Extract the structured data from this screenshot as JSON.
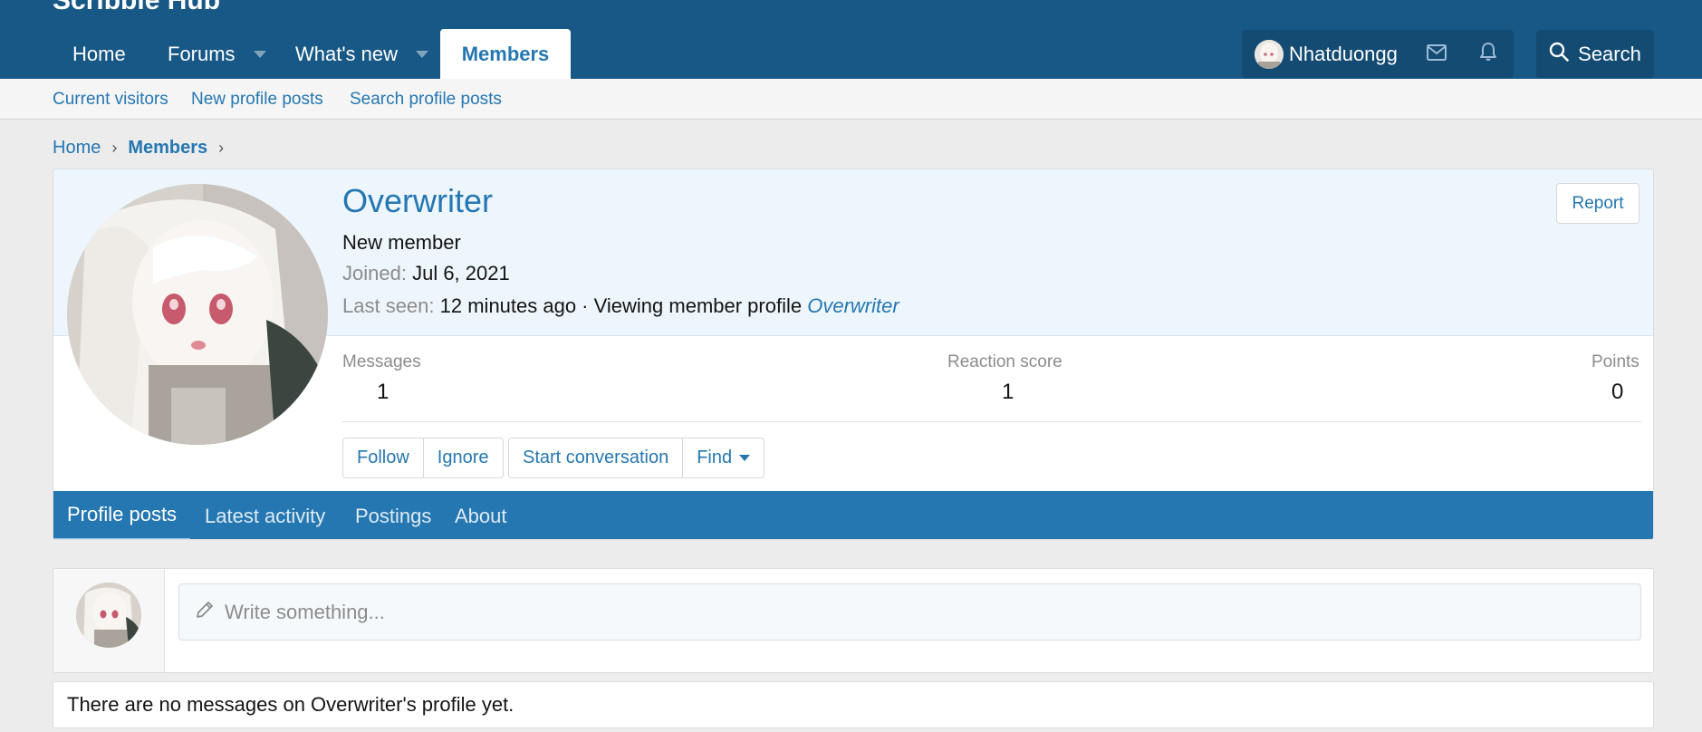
{
  "site": {
    "title": "Scribble Hub"
  },
  "nav": {
    "home": "Home",
    "forums": "Forums",
    "whats_new": "What's new",
    "members": "Members"
  },
  "user_bar": {
    "username": "Nhatduongg",
    "inbox_icon": "envelope-icon",
    "alerts_icon": "bell-icon",
    "search_label": "Search"
  },
  "subnav": {
    "current_visitors": "Current visitors",
    "new_profile_posts": "New profile posts",
    "search_profile_posts": "Search profile posts"
  },
  "breadcrumb": {
    "home": "Home",
    "members": "Members"
  },
  "profile": {
    "username": "Overwriter",
    "user_title": "New member",
    "joined_label": "Joined:",
    "joined_value": "Jul 6, 2021",
    "last_seen_label": "Last seen:",
    "last_seen_value": "12 minutes ago · Viewing member profile",
    "last_seen_link": "Overwriter",
    "report_label": "Report",
    "stats": {
      "messages_label": "Messages",
      "messages_value": "1",
      "reaction_label": "Reaction score",
      "reaction_value": "1",
      "points_label": "Points",
      "points_value": "0"
    },
    "buttons": {
      "follow": "Follow",
      "ignore": "Ignore",
      "start_conversation": "Start conversation",
      "find": "Find"
    },
    "tabs": {
      "profile_posts": "Profile posts",
      "latest_activity": "Latest activity",
      "postings": "Postings",
      "about": "About"
    }
  },
  "composer": {
    "placeholder": "Write something..."
  },
  "empty_message": "There are no messages on Overwriter's profile yet.",
  "colors": {
    "header_bg": "#185886",
    "accent": "#2577b1",
    "tab_bar": "#2577b1",
    "profile_head_bg": "#edf6fd"
  }
}
